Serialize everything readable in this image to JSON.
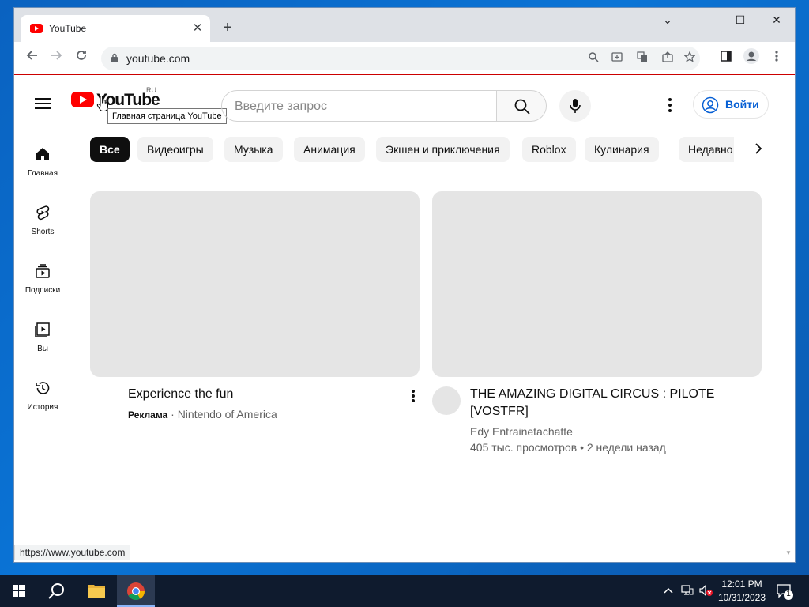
{
  "browser": {
    "tab_title": "YouTube",
    "tab_close": "✕",
    "new_tab": "+",
    "url": "youtube.com",
    "status_url": "https://www.youtube.com",
    "window_controls": {
      "minimize": "—",
      "maximize": "☐",
      "close": "✕",
      "menu": "⌄"
    }
  },
  "youtube": {
    "logo_text": "YouTube",
    "country_code": "RU",
    "logo_tooltip": "Главная страница YouTube",
    "search_placeholder": "Введите запрос",
    "signin_label": "Войти",
    "sidebar": [
      {
        "label": "Главная",
        "icon": "home-icon"
      },
      {
        "label": "Shorts",
        "icon": "shorts-icon"
      },
      {
        "label": "Подписки",
        "icon": "subscriptions-icon"
      },
      {
        "label": "Вы",
        "icon": "library-icon"
      },
      {
        "label": "История",
        "icon": "history-icon"
      }
    ],
    "chips": [
      "Все",
      "Видеоигры",
      "Музыка",
      "Анимация",
      "Экшен и приключения",
      "Roblox",
      "Кулинария",
      "Недавно"
    ],
    "videos": [
      {
        "title": "Experience the fun",
        "badge": "Реклама",
        "separator": " · ",
        "channel": "Nintendo of America"
      },
      {
        "title_line1": "THE AMAZING DIGITAL CIRCUS : PILOTE",
        "title_line2": "[VOSTFR]",
        "channel": "Edy Entrainetachatte",
        "stats": "405 тыс. просмотров • 2 недели назад"
      }
    ]
  },
  "taskbar": {
    "time": "12:01 PM",
    "date": "10/31/2023",
    "notification_count": "1"
  },
  "colors": {
    "accent": "#065fd4",
    "youtube_red": "#ff0000",
    "taskbar": "#0f1b2e"
  }
}
